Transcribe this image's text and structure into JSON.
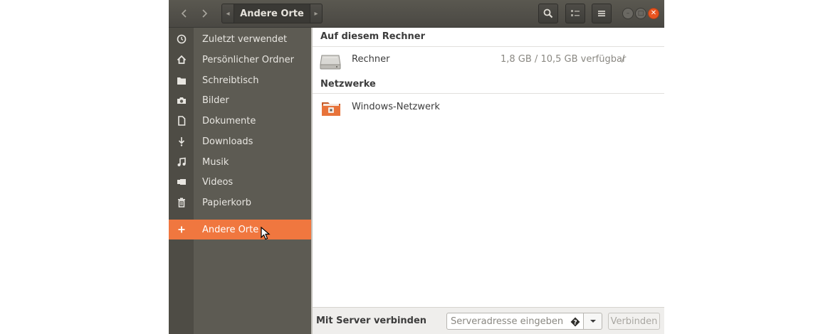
{
  "headerbar": {
    "location": "Andere Orte",
    "back_icon": "chevron-left-icon",
    "forward_icon": "chevron-right-icon",
    "search_icon": "search-icon",
    "view_icon": "list-view-icon",
    "menu_icon": "hamburger-menu-icon"
  },
  "sidebar": {
    "items": [
      {
        "label": "Zuletzt verwendet",
        "icon": "clock-icon"
      },
      {
        "label": "Persönlicher Ordner",
        "icon": "home-icon"
      },
      {
        "label": "Schreibtisch",
        "icon": "folder-icon"
      },
      {
        "label": "Bilder",
        "icon": "camera-icon"
      },
      {
        "label": "Dokumente",
        "icon": "document-icon"
      },
      {
        "label": "Downloads",
        "icon": "download-icon"
      },
      {
        "label": "Musik",
        "icon": "music-icon"
      },
      {
        "label": "Videos",
        "icon": "video-icon"
      },
      {
        "label": "Papierkorb",
        "icon": "trash-icon"
      }
    ],
    "other_places": {
      "label": "Andere Orte",
      "icon": "plus-icon"
    }
  },
  "main": {
    "this_computer": {
      "header": "Auf diesem Rechner",
      "items": [
        {
          "name": "Rechner",
          "space": "1,8 GB / 10,5 GB verfügbar",
          "mount": "/",
          "icon": "harddisk-icon"
        }
      ]
    },
    "networks": {
      "header": "Netzwerke",
      "items": [
        {
          "name": "Windows-Netzwerk",
          "icon": "network-folder-icon"
        }
      ]
    }
  },
  "bottombar": {
    "label": "Mit Server verbinden",
    "input_placeholder": "Serveradresse eingeben …",
    "connect_label": "Verbinden"
  },
  "colors": {
    "accent": "#f0773f",
    "sidebar_bg": "#5d5b53",
    "headerbar_bg": "#4a4843"
  }
}
